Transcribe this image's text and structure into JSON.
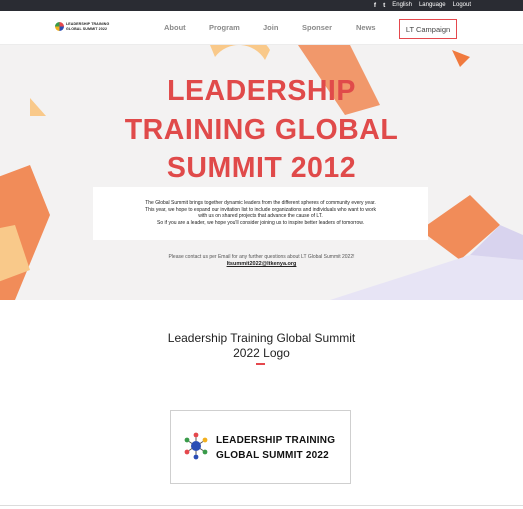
{
  "topbar": {
    "facebook_icon": "f",
    "twitter_icon": "t",
    "links": [
      "English",
      "Language",
      "Logout"
    ]
  },
  "logo": {
    "line1": "LEADERSHIP TRAINING",
    "line2": "GLOBAL SUMMIT 2022"
  },
  "nav": {
    "items": [
      "About",
      "Program",
      "Join",
      "Sponser",
      "News"
    ],
    "cta": "LT Campaign"
  },
  "hero": {
    "title": [
      "LEADERSHIP",
      "TRAINING GLOBAL",
      "SUMMIT 2012"
    ],
    "paragraph": [
      "The Global Summit brings together dynamic leaders from the different spheres of community every year.",
      "This year, we hope to expand our invitation list to include organizations and individuals who want to work",
      "with us on shared projects that advance the cause of LT.",
      "So if you are a leader, we hope you'll consider joining us to inspire better leaders of tomorrow."
    ],
    "contact_text": "Please contact us per Email for any further questions about LT Global Summit 2022!",
    "email": "ltsummit2022@ltkenya.org"
  },
  "logo_section": {
    "title": [
      "Leadership Training Global Summit",
      "2022 Logo"
    ],
    "card_line1": "LEADERSHIP TRAINING",
    "card_line2": "GLOBAL SUMMIT 2022"
  },
  "colors": {
    "accent": "#e04a4a",
    "orange": "#f07a3e",
    "peach": "#f9c98a",
    "lavender": "#e7e4f5"
  }
}
